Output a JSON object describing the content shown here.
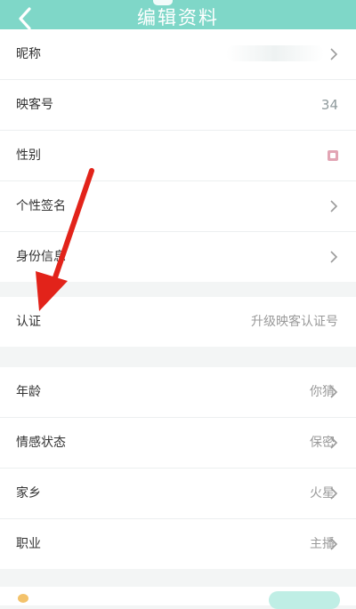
{
  "header": {
    "title": "编辑资料"
  },
  "group1": [
    {
      "label": "昵称"
    },
    {
      "label": "映客号",
      "value": "34"
    },
    {
      "label": "性别"
    },
    {
      "label": "个性签名"
    },
    {
      "label": "身份信息"
    }
  ],
  "group2": [
    {
      "label": "认证",
      "value": "升级映客认证号"
    }
  ],
  "group3": [
    {
      "label": "年龄",
      "value": "你猜"
    },
    {
      "label": "情感状态",
      "value": "保密"
    },
    {
      "label": "家乡",
      "value": "火星"
    },
    {
      "label": "职业",
      "value": "主播"
    }
  ],
  "colors": {
    "accent": "#7fd7c8",
    "arrow": "#e2231a"
  },
  "icons": {
    "back": "chevron-left-icon",
    "row": "chevron-right-icon"
  }
}
